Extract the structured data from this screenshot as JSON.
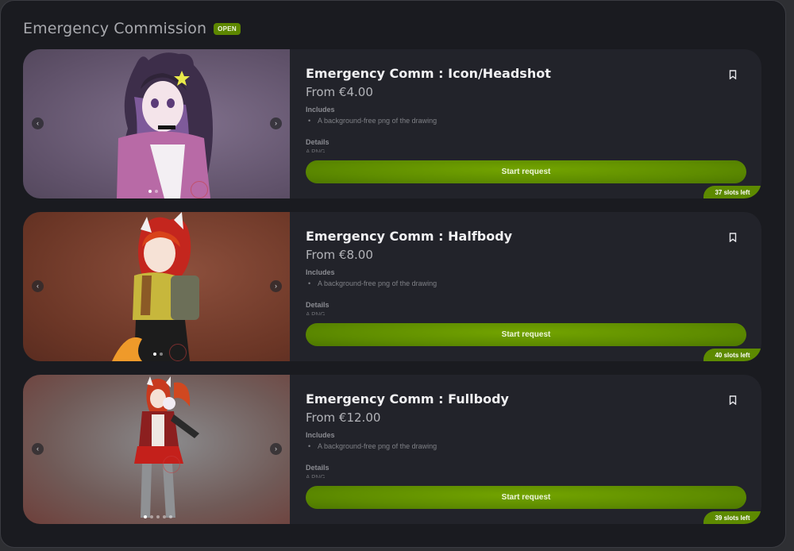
{
  "header": {
    "title": "Emergency Commission",
    "status": "OPEN"
  },
  "cards": [
    {
      "name": "Emergency Comm : Icon/Headshot",
      "price": "From €4.00",
      "includes_label": "Includes",
      "includes_item": "A background-free png of the drawing",
      "details_label": "Details",
      "details_item": "A PNG",
      "button": "Start request",
      "slots": "37 slots left",
      "image_dots": 2,
      "active_dot": 0
    },
    {
      "name": "Emergency Comm : Halfbody",
      "price": "From €8.00",
      "includes_label": "Includes",
      "includes_item": "A background-free png of the drawing",
      "details_label": "Details",
      "details_item": "A PNG",
      "button": "Start request",
      "slots": "40 slots left",
      "image_dots": 2,
      "active_dot": 0
    },
    {
      "name": "Emergency Comm : Fullbody",
      "price": "From €12.00",
      "includes_label": "Includes",
      "includes_item": "A background-free png of the drawing",
      "details_label": "Details",
      "details_item": "A PNG",
      "button": "Start request",
      "slots": "39 slots left",
      "image_dots": 5,
      "active_dot": 0
    }
  ],
  "colors": {
    "accent": "#5d8a00",
    "background": "#1a1b20",
    "card": "#22232a"
  },
  "icons": {
    "prev": "chevron-left-icon",
    "next": "chevron-right-icon",
    "bookmark": "bookmark-icon"
  }
}
